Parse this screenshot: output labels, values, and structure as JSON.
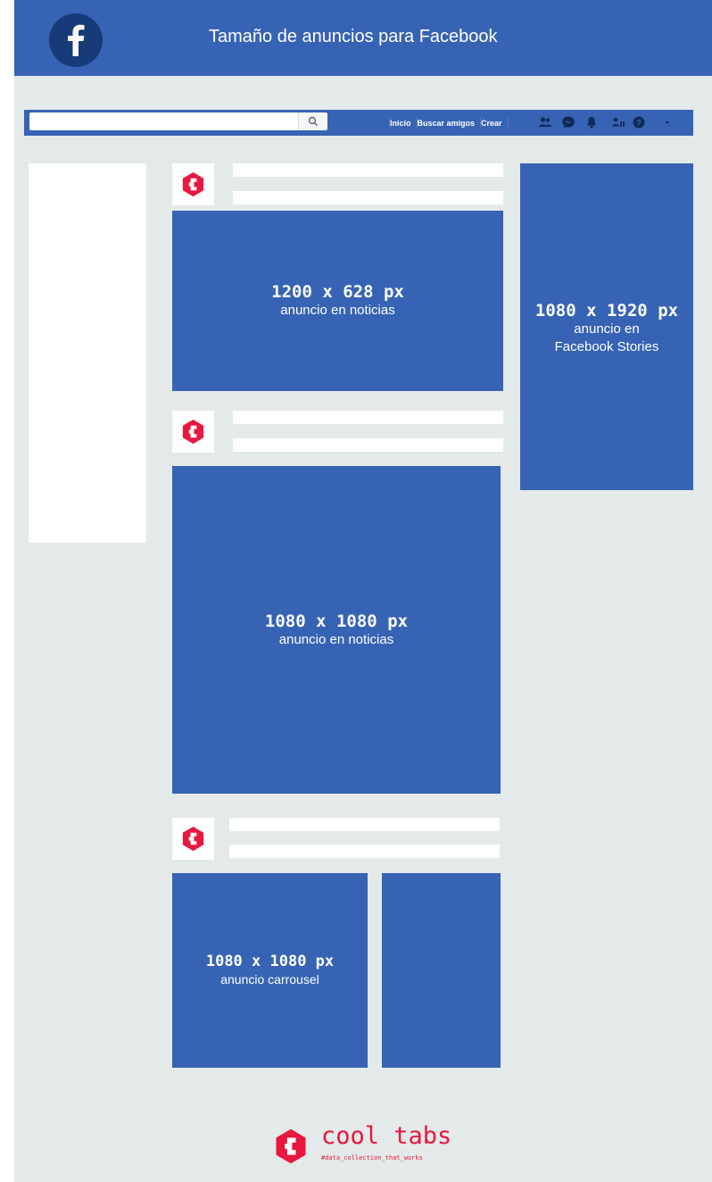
{
  "header": {
    "title": "Tamaño de anuncios para Facebook",
    "logo_icon": "facebook-f-icon"
  },
  "fb_navbar": {
    "search_placeholder": "",
    "search_icon": "search-icon",
    "links": [
      "Inicio",
      "Buscar amigos",
      "Crear"
    ],
    "icons": [
      "friends-icon",
      "messenger-icon",
      "bell-icon",
      "friend-requests-icon",
      "help-icon",
      "chevron-down-icon"
    ]
  },
  "ads": {
    "news_landscape": {
      "size": "1200 x 628 px",
      "label": "anuncio en noticias"
    },
    "stories": {
      "size": "1080 x 1920 px",
      "label_line1": "anuncio en",
      "label_line2": "Facebook Stories"
    },
    "news_square": {
      "size": "1080 x 1080 px",
      "label": "anuncio en noticias"
    },
    "carrousel": {
      "size": "1080 x 1080 px",
      "label": "anuncio carrousel"
    }
  },
  "footer": {
    "brand": "cool tabs",
    "tagline": "#data_collection_that_works",
    "logo_icon": "cooltabs-logo-icon"
  },
  "colors": {
    "facebook_blue": "#3763b4",
    "background": "#e4e9e9",
    "brand_red": "#e8173f"
  }
}
